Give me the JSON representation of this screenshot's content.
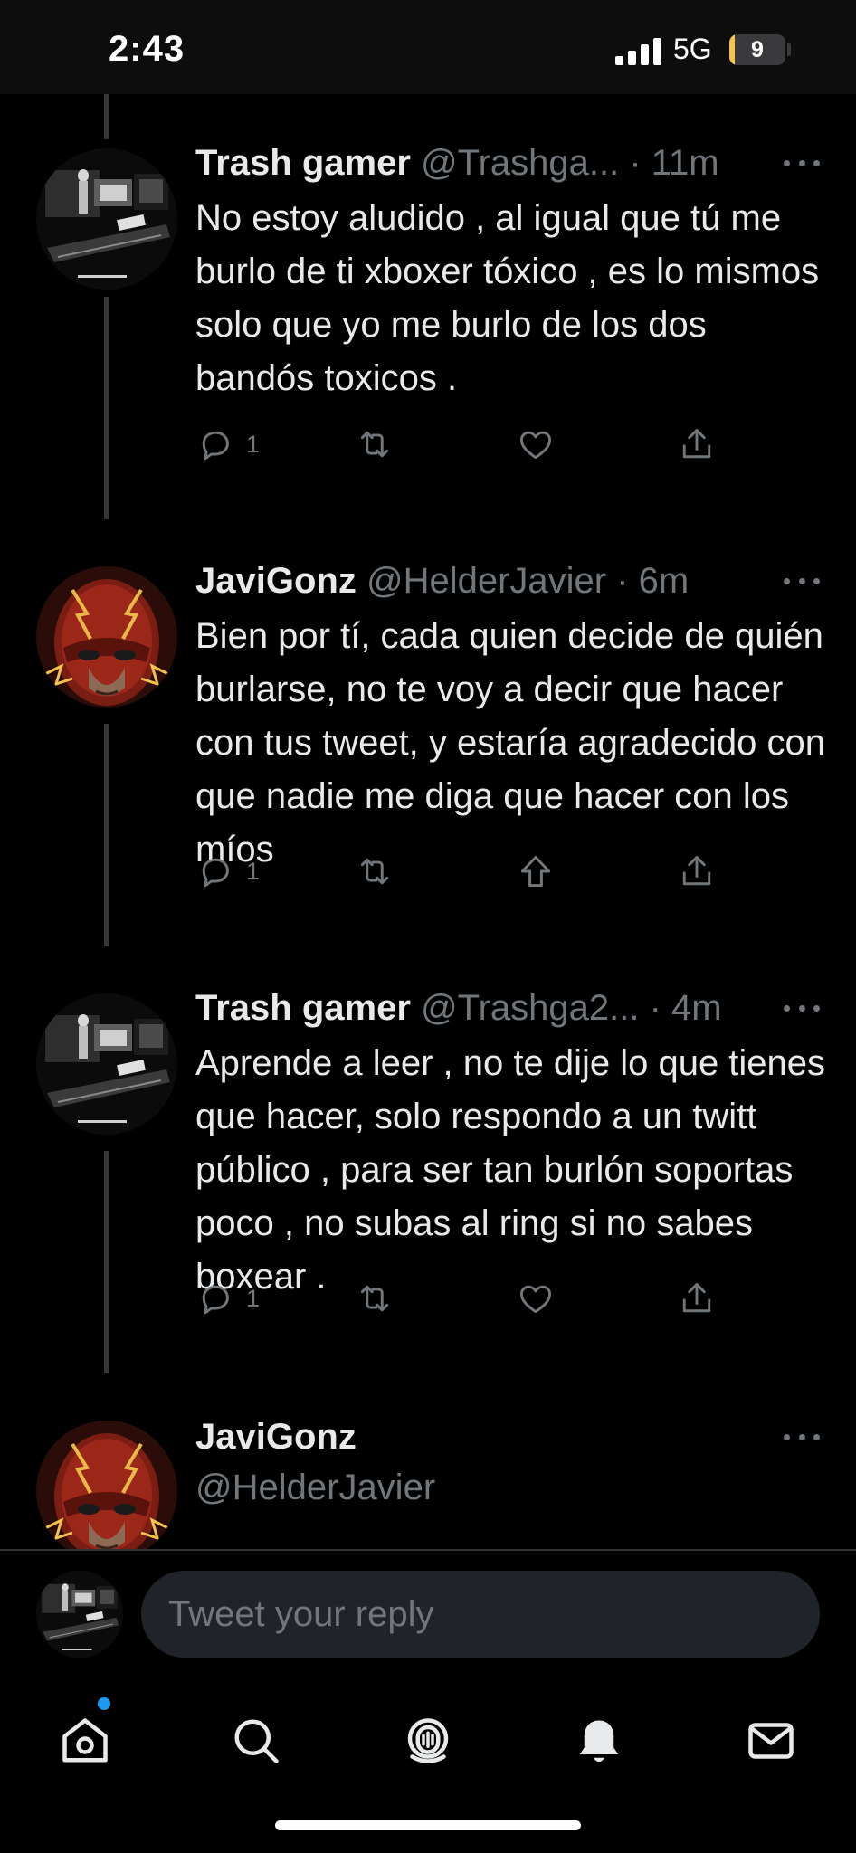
{
  "status_bar": {
    "time": "2:43",
    "network": "5G",
    "battery": "9",
    "battery_level": 0.09
  },
  "tweets": [
    {
      "name": "Trash gamer",
      "handle": "@Trashga...",
      "time": "· 11m",
      "text": "No estoy aludido , al igual que tú me burlo de ti  xboxer tóxico , es lo mismos solo que yo me burlo de los dos bandós toxicos .",
      "reply_count": "1",
      "avatar": "dark-room-avatar",
      "like_icon": "heart-icon"
    },
    {
      "name": "JaviGonz",
      "handle": "@HelderJavier",
      "time": "· 6m",
      "text": "Bien por tí, cada quien decide de quién burlarse, no te voy a decir que hacer con tus tweet, y estaría agradecido con que nadie me diga que hacer con los míos",
      "reply_count": "1",
      "avatar": "flash-mask-avatar",
      "like_icon": "upvote-arrow-icon"
    },
    {
      "name": "Trash gamer",
      "handle": "@Trashga2...",
      "time": "· 4m",
      "text": "Aprende a leer , no te dije lo que tienes que hacer, solo respondo a un twitt público , para ser tan burlón soportas poco , no subas al ring si no sabes boxear .",
      "reply_count": "1",
      "avatar": "dark-room-avatar",
      "like_icon": "heart-icon"
    },
    {
      "name": "JaviGonz",
      "handle": "@HelderJavier",
      "avatar": "flash-mask-avatar"
    }
  ],
  "reply_bar": {
    "placeholder": "Tweet your reply"
  },
  "tab_bar": {
    "items": [
      "home-icon",
      "search-icon",
      "spaces-icon",
      "notifications-icon",
      "messages-icon"
    ],
    "notification_dot_color": "#1d9bf0"
  },
  "colors": {
    "background": "#000000",
    "text_primary": "#e7e9ea",
    "text_secondary": "#71767b",
    "accent": "#1d9bf0"
  }
}
